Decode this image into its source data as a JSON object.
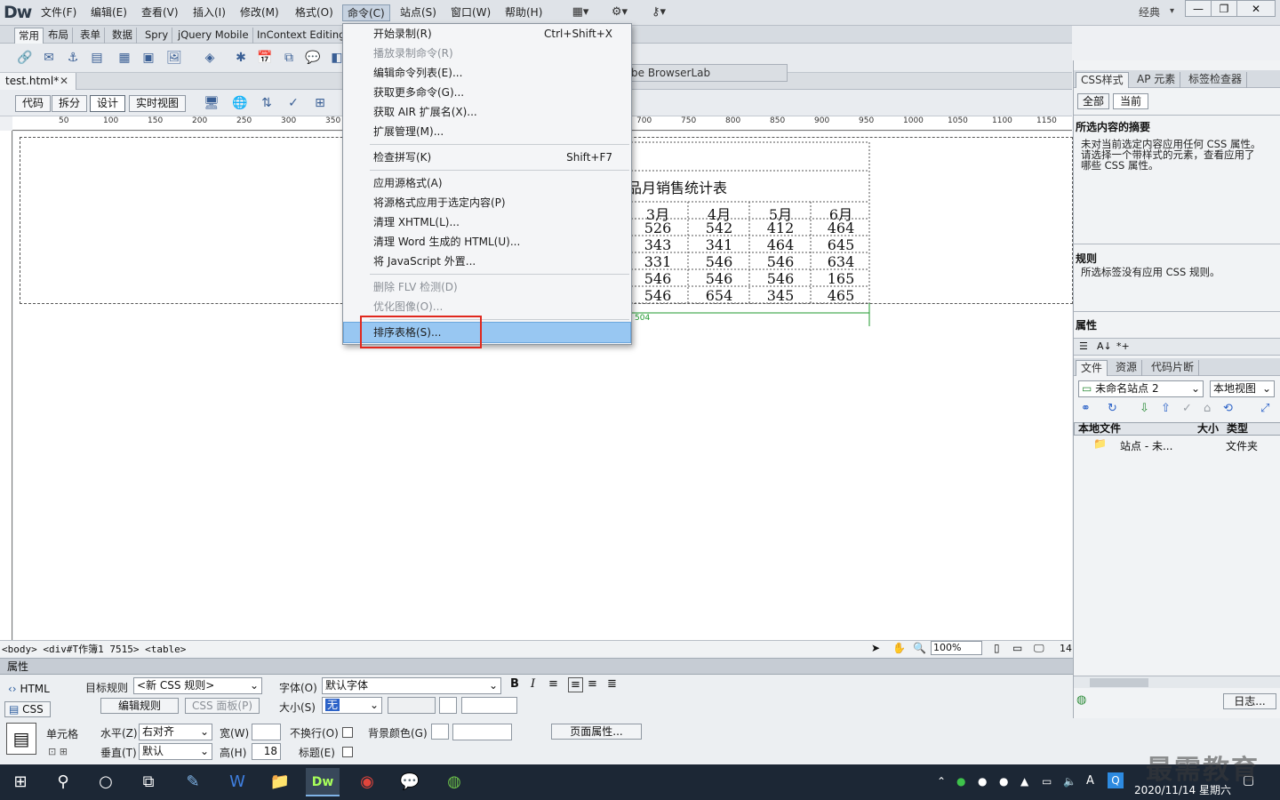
{
  "app": {
    "logo": "Dw",
    "workspace": "经典",
    "win_min": "—",
    "win_max": "❐",
    "win_close": "✕"
  },
  "menu": [
    "文件(F)",
    "编辑(E)",
    "查看(V)",
    "插入(I)",
    "修改(M)",
    "格式(O)",
    "命令(C)",
    "站点(S)",
    "窗口(W)",
    "帮助(H)"
  ],
  "insert_tabs": [
    "常用",
    "布局",
    "表单",
    "数据",
    "Spry",
    "jQuery Mobile",
    "InContext Editing"
  ],
  "doc": {
    "tab": "test.html*",
    "close": "✕",
    "browserlab": "be BrowserLab"
  },
  "view_buttons": [
    "代码",
    "拆分",
    "设计",
    "实时视图"
  ],
  "ruler_ticks": [
    "50",
    "100",
    "150",
    "200",
    "250",
    "300",
    "350",
    "700",
    "750",
    "800",
    "850",
    "900",
    "950",
    "1000",
    "1050",
    "1100",
    "1150"
  ],
  "table": {
    "caption": "品月销售统计表",
    "headers": [
      "3月",
      "4月",
      "5月",
      "6月"
    ],
    "rows": [
      [
        "526",
        "542",
        "412",
        "464"
      ],
      [
        "343",
        "341",
        "464",
        "645"
      ],
      [
        "331",
        "546",
        "546",
        "634"
      ],
      [
        "546",
        "546",
        "546",
        "165"
      ],
      [
        "546",
        "654",
        "345",
        "465"
      ]
    ],
    "width_label": "504"
  },
  "dropdown": {
    "items": [
      {
        "label": "开始录制(R)",
        "shortcut": "Ctrl+Shift+X",
        "disabled": false
      },
      {
        "label": "播放录制命令(R)",
        "shortcut": "",
        "disabled": true
      },
      {
        "label": "编辑命令列表(E)...",
        "shortcut": "",
        "disabled": false
      },
      {
        "label": "获取更多命令(G)...",
        "shortcut": "",
        "disabled": false
      },
      {
        "label": "获取 AIR 扩展名(X)...",
        "shortcut": "",
        "disabled": false
      },
      {
        "label": "扩展管理(M)...",
        "shortcut": "",
        "disabled": false
      },
      {
        "label": "检查拼写(K)",
        "shortcut": "Shift+F7",
        "disabled": false
      },
      {
        "label": "应用源格式(A)",
        "shortcut": "",
        "disabled": false
      },
      {
        "label": "将源格式应用于选定内容(P)",
        "shortcut": "",
        "disabled": false
      },
      {
        "label": "清理 XHTML(L)...",
        "shortcut": "",
        "disabled": false
      },
      {
        "label": "清理 Word 生成的 HTML(U)...",
        "shortcut": "",
        "disabled": false
      },
      {
        "label": "将 JavaScript 外置...",
        "shortcut": "",
        "disabled": false
      },
      {
        "label": "删除 FLV 检测(D)",
        "shortcut": "",
        "disabled": true
      },
      {
        "label": "优化图像(O)...",
        "shortcut": "",
        "disabled": true
      },
      {
        "label": "排序表格(S)...",
        "shortcut": "",
        "disabled": false
      }
    ]
  },
  "status": {
    "tag_selector": "<body> <div#T作簿1 7515> <table>",
    "zoom": "100%",
    "size": "14:"
  },
  "properties": {
    "title": "属性",
    "html_btn": "HTML",
    "css_btn": "CSS",
    "target_rule_label": "目标规则",
    "target_rule_value": "<新 CSS 规则>",
    "edit_rule": "编辑规则",
    "css_panel": "CSS 面板(P)",
    "font_label": "字体(O)",
    "font_value": "默认字体",
    "size_label": "大小(S)",
    "size_value": "无",
    "bold": "B",
    "italic": "I",
    "cell_label": "单元格",
    "horiz_label": "水平(Z)",
    "horiz_value": "右对齐",
    "vert_label": "垂直(T)",
    "vert_value": "默认",
    "width_label": "宽(W)",
    "height_label": "高(H)",
    "height_value": "18",
    "nowrap_label": "不换行(O)",
    "header_label": "标题(E)",
    "bg_label": "背景颜色(G)",
    "page_props": "页面属性..."
  },
  "right_panel": {
    "css_tabs": [
      "CSS样式",
      "AP 元素",
      "标签检查器"
    ],
    "all": "全部",
    "current": "当前",
    "summary_head": "所选内容的摘要",
    "summary_text": [
      "未对当前选定内容应用任何 CSS 属性。",
      "请选择一个带样式的元素，查看应用了",
      "哪些 CSS 属性。"
    ],
    "rules_head": "规则",
    "rules_text": "所选标签没有应用 CSS 规则。",
    "props_head": "属性",
    "file_tabs": [
      "文件",
      "资源",
      "代码片断"
    ],
    "site": "未命名站点 2",
    "view": "本地视图",
    "col_local": "本地文件",
    "col_size": "大小",
    "col_type": "类型",
    "row_name": "站点 - 未...",
    "row_type": "文件夹",
    "log": "日志..."
  },
  "taskbar": {
    "clock": "2020/11/14 星期六",
    "ime": "A"
  },
  "watermark": "最需教育"
}
